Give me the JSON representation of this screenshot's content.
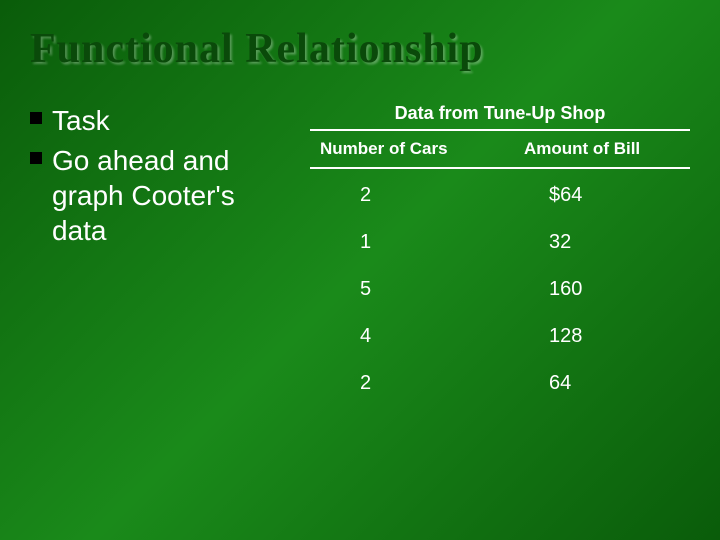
{
  "title": "Functional Relationship",
  "bullets": [
    "Task",
    "Go ahead and graph Cooter's data"
  ],
  "table": {
    "title": "Data from Tune-Up Shop",
    "headers": [
      "Number of Cars",
      "Amount of Bill"
    ]
  },
  "chart_data": {
    "type": "table",
    "title": "Data from Tune-Up Shop",
    "columns": [
      "Number of Cars",
      "Amount of Bill"
    ],
    "rows": [
      {
        "cars": 2,
        "bill": "$64"
      },
      {
        "cars": 1,
        "bill": "32"
      },
      {
        "cars": 5,
        "bill": "160"
      },
      {
        "cars": 4,
        "bill": "128"
      },
      {
        "cars": 2,
        "bill": "64"
      }
    ]
  }
}
